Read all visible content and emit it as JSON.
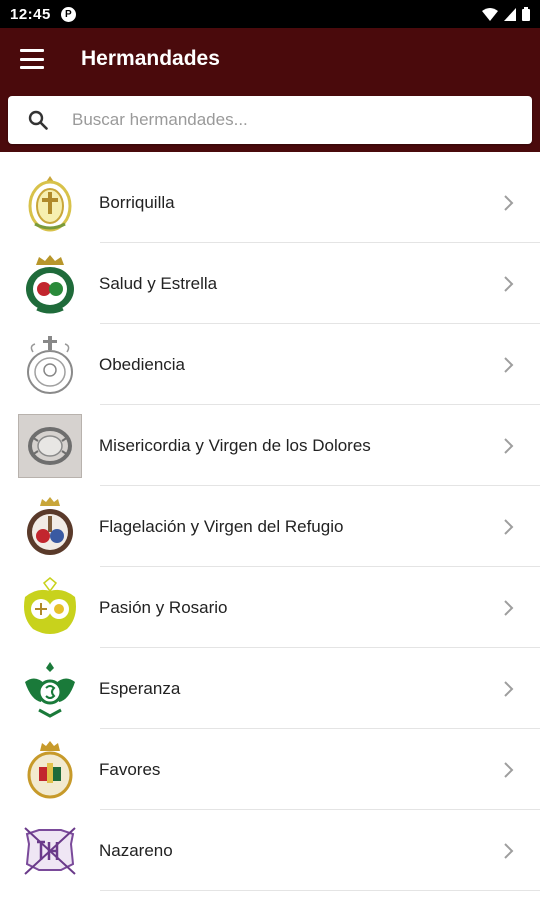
{
  "status_bar": {
    "time": "12:45",
    "app_icon_letter": "P"
  },
  "header": {
    "title": "Hermandades",
    "background": "#4a0a0c"
  },
  "search": {
    "placeholder": "Buscar hermandades...",
    "value": ""
  },
  "items": [
    {
      "label": "Borriquilla",
      "icon": "crest-borriquilla-icon",
      "color": "#d8c24a"
    },
    {
      "label": "Salud y Estrella",
      "icon": "crest-salud-estrella-icon",
      "color": "#1f6b3a"
    },
    {
      "label": "Obediencia",
      "icon": "crest-obediencia-icon",
      "color": "#9a9a9a"
    },
    {
      "label": "Misericordia y Virgen de los Dolores",
      "icon": "crest-misericordia-icon",
      "color": "#7a7a7a"
    },
    {
      "label": "Flagelación y Virgen del Refugio",
      "icon": "crest-flagelacion-icon",
      "color": "#8a2a2a"
    },
    {
      "label": "Pasión y Rosario",
      "icon": "crest-pasion-rosario-icon",
      "color": "#c8d21c"
    },
    {
      "label": "Esperanza",
      "icon": "crest-esperanza-icon",
      "color": "#1a7a3a"
    },
    {
      "label": "Favores",
      "icon": "crest-favores-icon",
      "color": "#c79a2a"
    },
    {
      "label": "Nazareno",
      "icon": "crest-nazareno-icon",
      "color": "#6a3a8a"
    }
  ]
}
